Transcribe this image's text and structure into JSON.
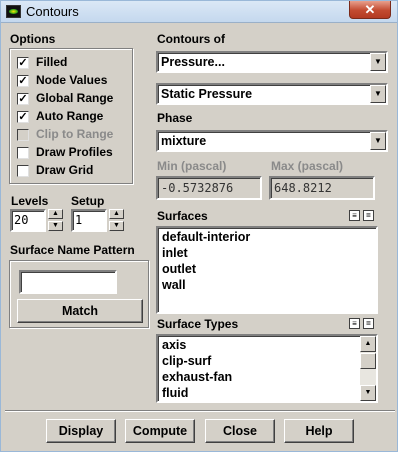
{
  "window": {
    "title": "Contours",
    "close_glyph": "✕"
  },
  "options": {
    "heading": "Options",
    "items": [
      {
        "label": "Filled",
        "checked": true,
        "enabled": true
      },
      {
        "label": "Node Values",
        "checked": true,
        "enabled": true
      },
      {
        "label": "Global Range",
        "checked": true,
        "enabled": true
      },
      {
        "label": "Auto Range",
        "checked": true,
        "enabled": true
      },
      {
        "label": "Clip to Range",
        "checked": false,
        "enabled": false
      },
      {
        "label": "Draw Profiles",
        "checked": false,
        "enabled": true
      },
      {
        "label": "Draw Grid",
        "checked": false,
        "enabled": true
      }
    ],
    "check_glyph": "✓"
  },
  "levels": {
    "label": "Levels",
    "value": "20"
  },
  "setup": {
    "label": "Setup",
    "value": "1"
  },
  "surface_name_pattern": {
    "label": "Surface Name Pattern",
    "value": "",
    "match_label": "Match"
  },
  "contours_of": {
    "heading": "Contours of",
    "category": "Pressure...",
    "quantity": "Static Pressure"
  },
  "phase": {
    "heading": "Phase",
    "value": "mixture"
  },
  "min": {
    "label": "Min (pascal)",
    "value": "-0.5732876"
  },
  "max": {
    "label": "Max (pascal)",
    "value": "648.8212"
  },
  "surfaces": {
    "heading": "Surfaces",
    "items": [
      "default-interior",
      "inlet",
      "outlet",
      "wall"
    ]
  },
  "surface_types": {
    "heading": "Surface Types",
    "items": [
      "axis",
      "clip-surf",
      "exhaust-fan",
      "fluid"
    ]
  },
  "buttons": {
    "display": "Display",
    "compute": "Compute",
    "close": "Close",
    "help": "Help"
  },
  "icons": {
    "spin_up": "▲",
    "spin_down": "▼",
    "dropdown": "▼",
    "select_all": "≡",
    "deselect_all": "="
  }
}
